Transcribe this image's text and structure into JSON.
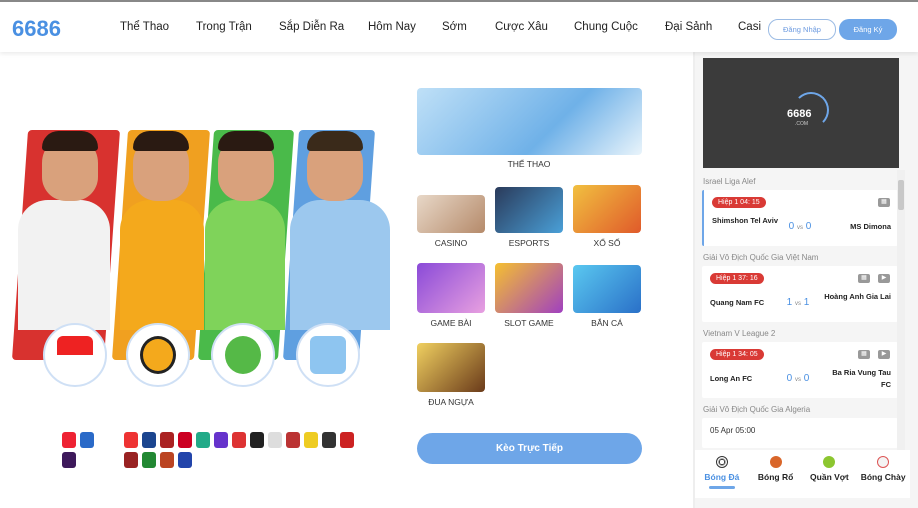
{
  "header": {
    "logo": "6686",
    "nav": [
      "Thể Thao",
      "Trong Trận",
      "Sắp Diễn Ra",
      "Hôm Nay",
      "Sớm",
      "Cược Xâu",
      "Chung Cuộc",
      "Đại Sảnh",
      "Casi"
    ],
    "login": "Đăng Nhập",
    "register": "Đăng Ký"
  },
  "games": {
    "featured": "THỂ THAO",
    "items": [
      "CASINO",
      "ESPORTS",
      "XỔ SỐ",
      "GAME BÀI",
      "SLOT GAME",
      "BẮN CÁ",
      "ĐUA NGỰA"
    ]
  },
  "live_button": "Kèo Trực Tiếp",
  "video": {
    "logo": "6686",
    "sub": ".COM"
  },
  "matches": [
    {
      "league": "Israel Liga Alef",
      "status": "Hiệp 1   04: 15",
      "home": "Shimshon Tel Aviv",
      "away": "MS Dimona",
      "home_score": "0",
      "away_score": "0",
      "vs": "vs"
    },
    {
      "league": "Giải Vô Địch Quốc Gia Việt Nam",
      "status": "Hiệp 1   37: 16",
      "home": "Quang Nam FC",
      "away": "Hoàng Anh Gia Lai",
      "home_score": "1",
      "away_score": "1",
      "vs": "vs"
    },
    {
      "league": "Vietnam V League 2",
      "status": "Hiệp 1   34: 05",
      "home": "Long An FC",
      "away": "Ba Ria Vung Tau FC",
      "home_score": "0",
      "away_score": "0",
      "vs": "vs"
    },
    {
      "league": "Giải Vô Địch Quốc Gia Algeria",
      "schedule": "05 Apr  05:00"
    }
  ],
  "sport_tabs": [
    {
      "label": "Bóng Đá",
      "icon": "soccer-ball-icon"
    },
    {
      "label": "Bóng Rổ",
      "icon": "basketball-icon"
    },
    {
      "label": "Quần Vợt",
      "icon": "tennis-ball-icon"
    },
    {
      "label": "Bóng Chày",
      "icon": "baseball-icon"
    }
  ],
  "colors": {
    "accent": "#6ea6e8",
    "live": "#d93a35",
    "logo": "#4a90e2"
  }
}
